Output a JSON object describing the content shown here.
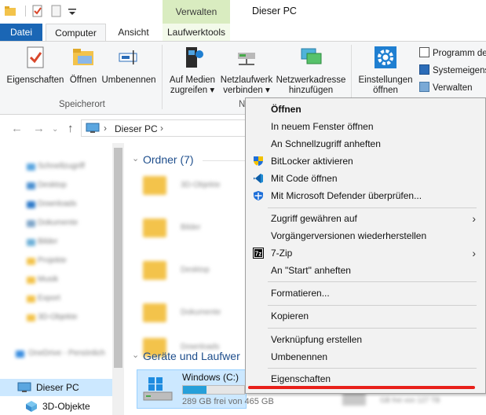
{
  "window": {
    "title": "Dieser PC",
    "contextual_tab_group": "Verwalten"
  },
  "ribbon_tabs": [
    "Datei",
    "Computer",
    "Ansicht",
    "Laufwerktools"
  ],
  "ribbon": {
    "speicherort": {
      "label": "Speicherort",
      "buttons": [
        "Eigenschaften",
        "Öffnen",
        "Umbenennen"
      ]
    },
    "netzwerk": {
      "label_partial": "N",
      "buttons": [
        {
          "line1": "Auf Medien",
          "line2": "zugreifen ▾"
        },
        {
          "line1": "Netzlaufwerk",
          "line2": "verbinden ▾"
        },
        {
          "line1": "Netzwerkadresse",
          "line2": "hinzufügen"
        }
      ]
    },
    "system": {
      "big_button": {
        "line1": "Einstellungen",
        "line2": "öffnen"
      },
      "small_buttons": [
        "Programm de",
        "Systemeigens",
        "Verwalten"
      ]
    }
  },
  "address_bar": {
    "path": "Dieser PC",
    "separator": "›"
  },
  "navigation_pane": {
    "items": [
      "Schnellzugriff",
      "Desktop",
      "Downloads",
      "Dokumente",
      "Bilder",
      "Projekte",
      "Musik",
      "Export",
      "3D-Objekte",
      "OneDrive - Persönlich"
    ],
    "selected": "Dieser PC",
    "next": "3D-Objekte"
  },
  "content": {
    "folders_header": "Ordner (7)",
    "folders": [
      "3D-Objekte",
      "Bilder",
      "Desktop",
      "Dokumente",
      "Downloads"
    ],
    "drives_header": "Geräte und Laufwer",
    "drive": {
      "name": "Windows (C:)",
      "free": "289 GB frei von 465 GB",
      "used_fraction": 0.38
    },
    "drive2_partial": "GB frei von 127 TB"
  },
  "context_menu": {
    "items": [
      {
        "label": "Öffnen",
        "bold": true
      },
      {
        "label": "In neuem Fenster öffnen"
      },
      {
        "label": "An Schnellzugriff anheften"
      },
      {
        "label": "BitLocker aktivieren",
        "icon": "shield-icon"
      },
      {
        "label": "Mit Code öffnen",
        "icon": "vscode-icon"
      },
      {
        "label": "Mit Microsoft Defender überprüfen...",
        "icon": "defender-icon"
      },
      {
        "label": "Zugriff gewähren auf",
        "submenu": true
      },
      {
        "label": "Vorgängerversionen wiederherstellen"
      },
      {
        "label": "7-Zip",
        "icon": "7zip-icon",
        "submenu": true
      },
      {
        "label": "An \"Start\" anheften"
      },
      {
        "label": "Formatieren..."
      },
      {
        "label": "Kopieren"
      },
      {
        "label": "Verknüpfung erstellen"
      },
      {
        "label": "Umbenennen"
      },
      {
        "label": "Eigenschaften"
      }
    ],
    "arrow": "›",
    "highlight_color": "#e8201a"
  }
}
